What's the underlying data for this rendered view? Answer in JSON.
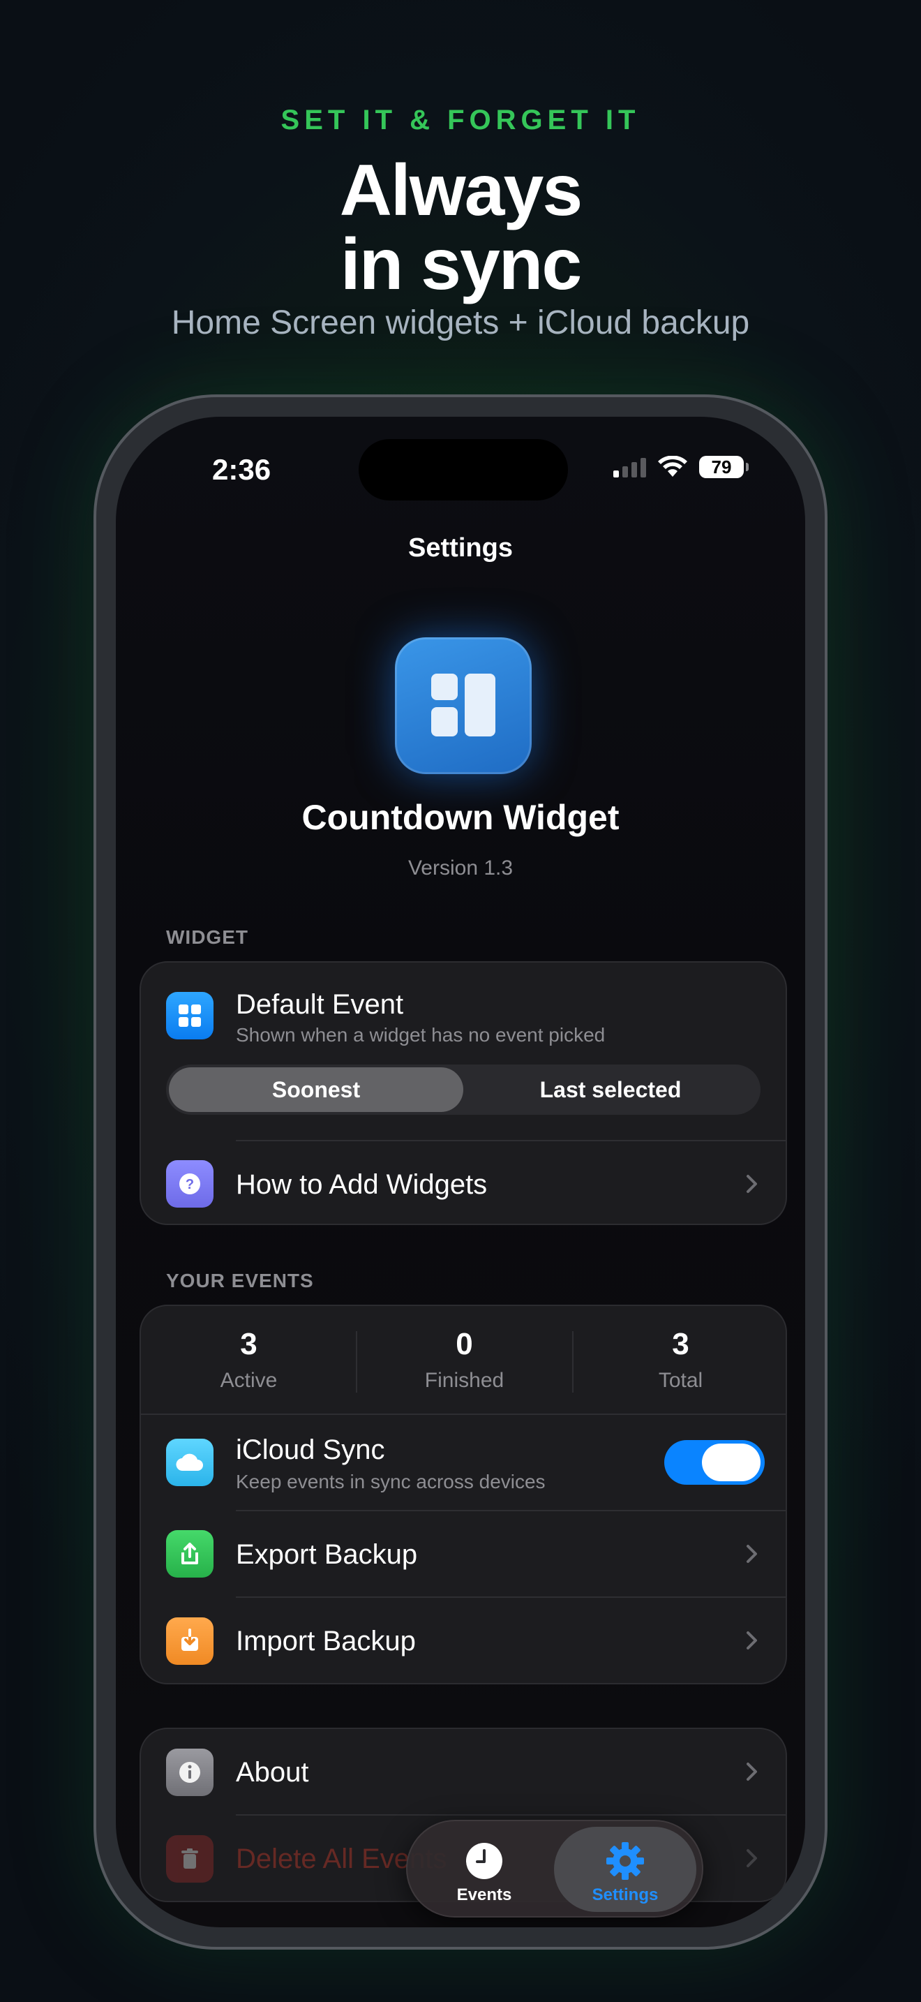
{
  "marketing": {
    "tagline": "SET IT & FORGET IT",
    "headline_line1": "Always",
    "headline_line2": "in sync",
    "subheadline": "Home Screen widgets + iCloud backup"
  },
  "status_bar": {
    "time": "2:36",
    "battery": "79"
  },
  "nav": {
    "title": "Settings"
  },
  "app": {
    "name": "Countdown Widget",
    "version": "Version 1.3"
  },
  "widget_section": {
    "header": "WIDGET",
    "default_event": {
      "title": "Default Event",
      "subtitle": "Shown when a widget has no event picked"
    },
    "segmented": {
      "options": [
        "Soonest",
        "Last selected"
      ],
      "selected": "Soonest"
    },
    "how_to": {
      "title": "How to Add Widgets"
    }
  },
  "events_section": {
    "header": "YOUR EVENTS",
    "stats": [
      {
        "value": "3",
        "label": "Active"
      },
      {
        "value": "0",
        "label": "Finished"
      },
      {
        "value": "3",
        "label": "Total"
      }
    ],
    "icloud": {
      "title": "iCloud Sync",
      "subtitle": "Keep events in sync across devices",
      "enabled": true
    },
    "export": {
      "title": "Export Backup"
    },
    "import": {
      "title": "Import Backup"
    }
  },
  "misc_section": {
    "about": {
      "title": "About"
    },
    "delete": {
      "title": "Delete All Events"
    }
  },
  "tab_bar": {
    "tabs": [
      {
        "label": "Events",
        "icon": "clock-icon"
      },
      {
        "label": "Settings",
        "icon": "gear-icon"
      }
    ],
    "selected": "Settings"
  },
  "colors": {
    "accent_green": "#35c659",
    "accent_blue": "#0a84ff",
    "destructive": "#c0392b"
  }
}
